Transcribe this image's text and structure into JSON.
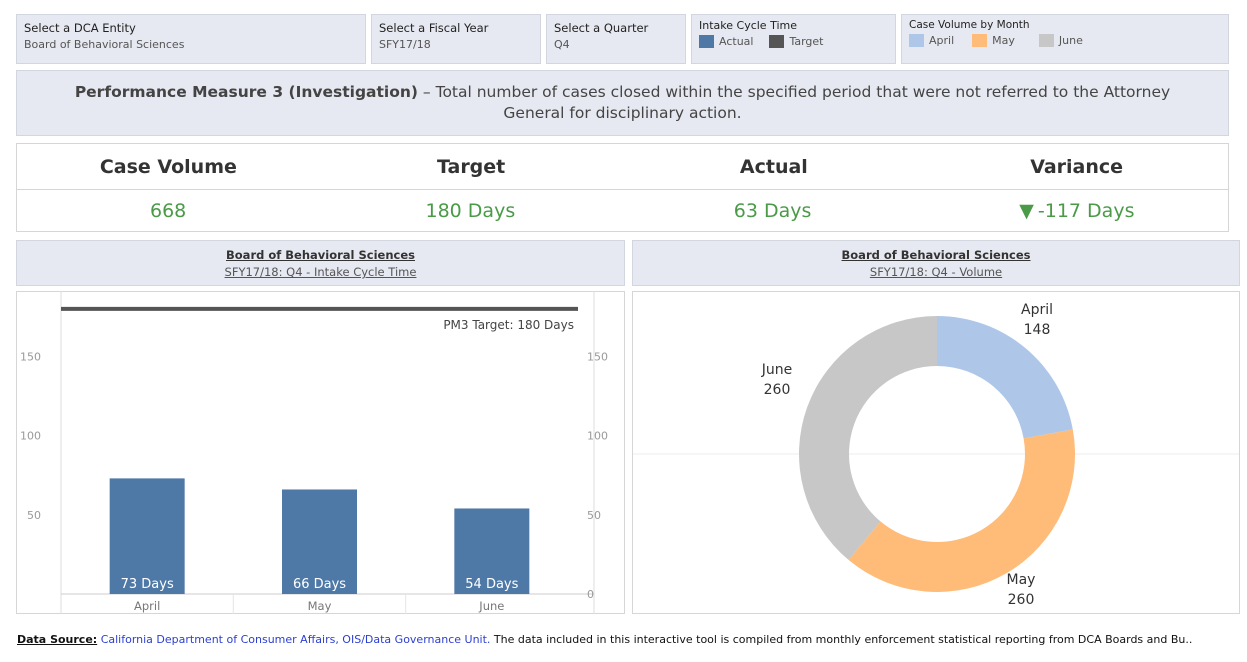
{
  "filters": {
    "entity": {
      "label": "Select a DCA Entity",
      "value": "Board of Behavioral Sciences"
    },
    "fiscal_year": {
      "label": "Select a Fiscal Year",
      "value": "SFY17/18"
    },
    "quarter": {
      "label": "Select a Quarter",
      "value": "Q4"
    },
    "intake_legend": {
      "label": "Intake Cycle Time",
      "items": [
        {
          "name": "Actual",
          "color": "#4e79a7"
        },
        {
          "name": "Target",
          "color": "#555555"
        }
      ]
    },
    "volume_legend": {
      "label": "Case Volume by Month",
      "items": [
        {
          "name": "April",
          "color": "#aec7e8"
        },
        {
          "name": "May",
          "color": "#ffbb78"
        },
        {
          "name": "June",
          "color": "#c7c7c7"
        }
      ]
    }
  },
  "measure": {
    "title": "Performance Measure 3 (Investigation)",
    "text": " – Total number of cases closed within the specified period that were not referred to the Attorney General for disciplinary action."
  },
  "kpis": {
    "headers": [
      "Case Volume",
      "Target",
      "Actual",
      "Variance"
    ],
    "values": [
      "668",
      "180 Days",
      "63 Days",
      "-117 Days"
    ],
    "variance_icon": "▼"
  },
  "left_panel": {
    "entity": "Board of Behavioral Sciences",
    "subtitle": "SFY17/18: Q4 -  Intake Cycle Time"
  },
  "right_panel": {
    "entity": "Board of Behavioral Sciences",
    "subtitle": "SFY17/18: Q4 - Volume"
  },
  "chart_data": [
    {
      "type": "bar",
      "categories": [
        "April",
        "May",
        "June"
      ],
      "values": [
        73,
        66,
        54
      ],
      "value_labels": [
        "73 Days",
        "66 Days",
        "54 Days"
      ],
      "ylim": [
        0,
        185
      ],
      "left_ticks": [
        50,
        100,
        150
      ],
      "right_ticks": [
        0,
        50,
        100,
        150
      ],
      "target": 180,
      "target_label": "PM3 Target: 180 Days",
      "bar_color": "#4e79a7",
      "target_color": "#555555"
    },
    {
      "type": "pie",
      "slices": [
        {
          "label": "April",
          "value": 148,
          "color": "#aec7e8"
        },
        {
          "label": "May",
          "value": 260,
          "color": "#ffbb78"
        },
        {
          "label": "June",
          "value": 260,
          "color": "#c7c7c7"
        }
      ]
    }
  ],
  "footer": {
    "source_label": "Data Source:",
    "source_link": "California Department of Consumer Affairs, OIS/Data Governance Unit.",
    "text": "  The data included in this interactive tool is compiled from monthly enforcement statistical reporting from DCA Boards and Bu.."
  }
}
